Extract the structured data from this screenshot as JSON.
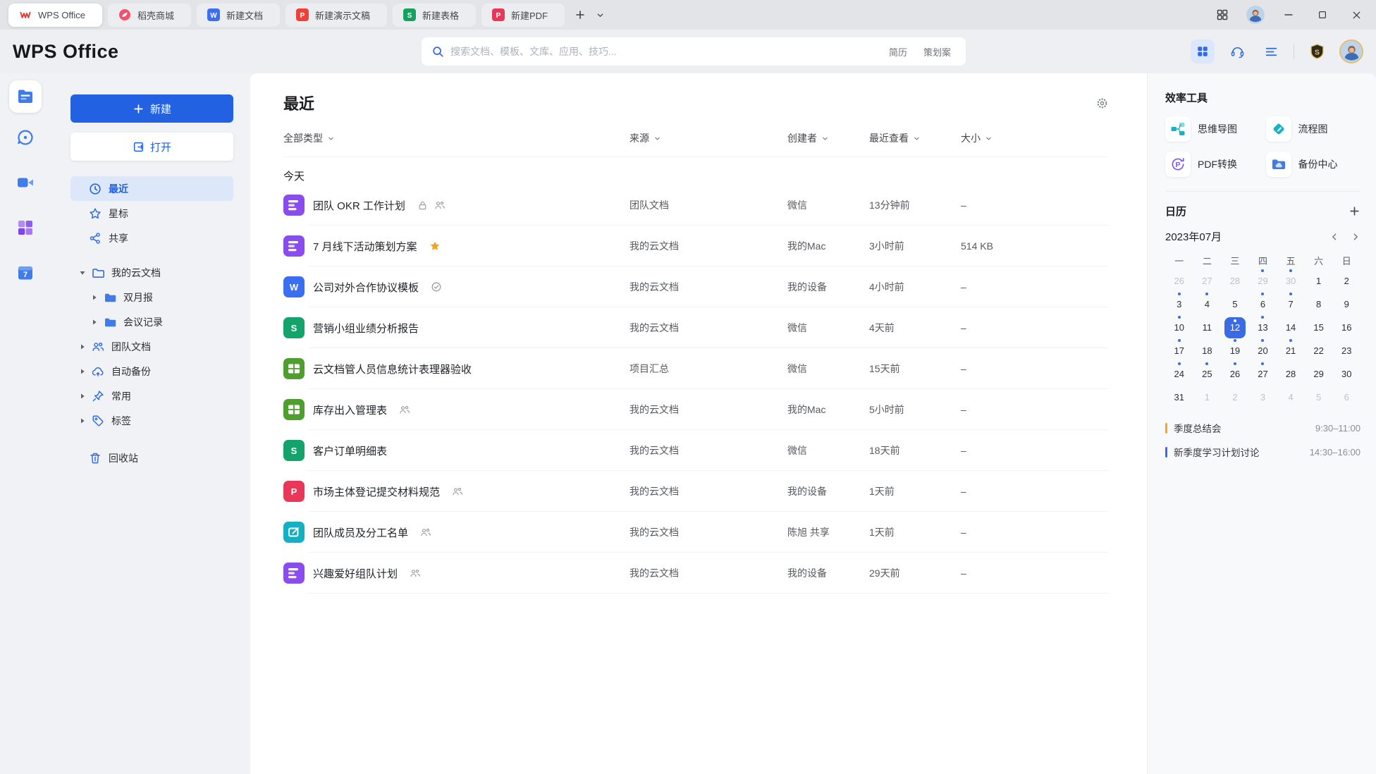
{
  "titlebar": {
    "tabs": [
      {
        "id": "wps-office",
        "label": "WPS Office",
        "active": true
      },
      {
        "id": "docer-mall",
        "label": "稻壳商城"
      },
      {
        "id": "new-doc",
        "label": "新建文档"
      },
      {
        "id": "new-ppt",
        "label": "新建演示文稿"
      },
      {
        "id": "new-sheet",
        "label": "新建表格"
      },
      {
        "id": "new-pdf",
        "label": "新建PDF"
      }
    ]
  },
  "header": {
    "logo": "WPS Office",
    "search_placeholder": "搜索文档、模板、文库、应用、技巧...",
    "search_tags": [
      "简历",
      "策划案"
    ]
  },
  "rail": {
    "items": [
      {
        "id": "docs",
        "active": true
      },
      {
        "id": "chat"
      },
      {
        "id": "meeting"
      },
      {
        "id": "apps"
      },
      {
        "id": "calendar"
      }
    ]
  },
  "sidebar": {
    "new_button": "新建",
    "open_button": "打开",
    "nav": [
      {
        "id": "recent",
        "icon": "clock",
        "label": "最近",
        "active": true
      },
      {
        "id": "starred",
        "icon": "star",
        "label": "星标"
      },
      {
        "id": "shared",
        "icon": "share",
        "label": "共享"
      }
    ],
    "tree": [
      {
        "id": "my-cloud-docs",
        "icon": "folder-outline",
        "caret": "down",
        "label": "我的云文档"
      },
      {
        "id": "bimonthly-report",
        "icon": "folder",
        "caret": "right",
        "label": "双月报",
        "child": true
      },
      {
        "id": "meeting-notes",
        "icon": "folder",
        "caret": "right",
        "label": "会议记录",
        "child": true
      },
      {
        "id": "team-docs",
        "icon": "team",
        "caret": "right",
        "label": "团队文档"
      },
      {
        "id": "auto-backup",
        "icon": "cloud-backup",
        "caret": "right",
        "label": "自动备份"
      },
      {
        "id": "frequent",
        "icon": "pin",
        "caret": "right",
        "label": "常用"
      },
      {
        "id": "tags",
        "icon": "tag",
        "caret": "right",
        "label": "标签"
      }
    ],
    "trash_label": "回收站"
  },
  "main": {
    "title": "最近",
    "filters": [
      {
        "id": "type",
        "label": "全部类型"
      },
      {
        "id": "source",
        "label": "来源"
      },
      {
        "id": "creator",
        "label": "创建者"
      },
      {
        "id": "viewed",
        "label": "最近查看"
      },
      {
        "id": "size",
        "label": "大小"
      }
    ],
    "group_label": "今天",
    "files": [
      {
        "name": "团队 OKR 工作计划",
        "icon": "docs",
        "badges": [
          "lock",
          "people"
        ],
        "source": "团队文档",
        "creator": "微信",
        "viewed": "13分钟前",
        "size": "–"
      },
      {
        "name": "7 月线下活动策划方案",
        "icon": "docs",
        "badges": [
          "star"
        ],
        "source": "我的云文档",
        "creator": "我的Mac",
        "viewed": "3小时前",
        "size": "514 KB"
      },
      {
        "name": "公司对外合作协议模板",
        "icon": "word",
        "badges": [
          "check"
        ],
        "source": "我的云文档",
        "creator": "我的设备",
        "viewed": "4小时前",
        "size": "–"
      },
      {
        "name": "营销小组业绩分析报告",
        "icon": "sheet",
        "badges": [],
        "source": "我的云文档",
        "creator": "微信",
        "viewed": "4天前",
        "size": "–"
      },
      {
        "name": "云文档管人员信息统计表理器验收",
        "icon": "table",
        "badges": [],
        "source": "项目汇总",
        "creator": "微信",
        "viewed": "15天前",
        "size": "–"
      },
      {
        "name": "库存出入管理表",
        "icon": "table",
        "badges": [
          "people"
        ],
        "source": "我的云文档",
        "creator": "我的Mac",
        "viewed": "5小时前",
        "size": "–"
      },
      {
        "name": "客户订单明细表",
        "icon": "sheet",
        "badges": [],
        "source": "我的云文档",
        "creator": "微信",
        "viewed": "18天前",
        "size": "–"
      },
      {
        "name": "市场主体登记提交材料规范",
        "icon": "pdf",
        "badges": [
          "people"
        ],
        "source": "我的云文档",
        "creator": "我的设备",
        "viewed": "1天前",
        "size": "–"
      },
      {
        "name": "团队成员及分工名单",
        "icon": "form",
        "badges": [
          "people"
        ],
        "source": "我的云文档",
        "creator": "陈旭 共享",
        "viewed": "1天前",
        "size": "–"
      },
      {
        "name": "兴趣爱好组队计划",
        "icon": "docs",
        "badges": [
          "people"
        ],
        "source": "我的云文档",
        "creator": "我的设备",
        "viewed": "29天前",
        "size": "–"
      }
    ]
  },
  "right_panel": {
    "tools_title": "效率工具",
    "tools": [
      {
        "id": "mindmap",
        "label": "思维导图"
      },
      {
        "id": "flowchart",
        "label": "流程图"
      },
      {
        "id": "pdf-convert",
        "label": "PDF转换"
      },
      {
        "id": "backup",
        "label": "备份中心"
      }
    ],
    "calendar": {
      "title": "日历",
      "month": "2023年07月",
      "weekdays": [
        "一",
        "二",
        "三",
        "四",
        "五",
        "六",
        "日"
      ],
      "days": [
        {
          "d": 26,
          "muted": true
        },
        {
          "d": 27,
          "muted": true
        },
        {
          "d": 28,
          "muted": true
        },
        {
          "d": 29,
          "muted": true,
          "dot": true
        },
        {
          "d": 30,
          "muted": true,
          "dot": true
        },
        {
          "d": 1
        },
        {
          "d": 2
        },
        {
          "d": 3,
          "dot": true
        },
        {
          "d": 4,
          "dot": true
        },
        {
          "d": 5
        },
        {
          "d": 6,
          "dot": true
        },
        {
          "d": 7,
          "dot": true
        },
        {
          "d": 8
        },
        {
          "d": 9
        },
        {
          "d": 10,
          "dot": true
        },
        {
          "d": 11
        },
        {
          "d": 12,
          "selected": true,
          "dot": true
        },
        {
          "d": 13,
          "dot": true
        },
        {
          "d": 14
        },
        {
          "d": 15
        },
        {
          "d": 16
        },
        {
          "d": 17,
          "dot": true
        },
        {
          "d": 18
        },
        {
          "d": 19,
          "dot": true
        },
        {
          "d": 20,
          "dot": true
        },
        {
          "d": 21,
          "dot": true
        },
        {
          "d": 22
        },
        {
          "d": 23
        },
        {
          "d": 24,
          "dot": true
        },
        {
          "d": 25,
          "dot": true
        },
        {
          "d": 26,
          "dot": true
        },
        {
          "d": 27,
          "dot": true
        },
        {
          "d": 28
        },
        {
          "d": 29
        },
        {
          "d": 30
        },
        {
          "d": 31
        },
        {
          "d": 1,
          "muted": true
        },
        {
          "d": 2,
          "muted": true
        },
        {
          "d": 3,
          "muted": true
        },
        {
          "d": 4,
          "muted": true
        },
        {
          "d": 5,
          "muted": true
        },
        {
          "d": 6,
          "muted": true
        }
      ],
      "events": [
        {
          "title": "季度总结会",
          "time": "9:30–11:00",
          "color": "#f5a623"
        },
        {
          "title": "新季度学习计划讨论",
          "time": "14:30–16:00",
          "color": "#3b6be4"
        }
      ]
    }
  },
  "colors": {
    "accent": "#2161e2",
    "star": "#f0a41f",
    "docs_icon": "#8a4bef",
    "word_icon": "#3a6ff2",
    "sheet_icon": "#14a36b",
    "table_icon": "#4f9f2f",
    "pdf_icon": "#e9375a",
    "form_icon": "#13b0c4",
    "tool_teal": "#14b3c7",
    "tool_purple": "#7a52f4",
    "folder_blue": "#3f7bea",
    "calendar_selected": "#3b6be4"
  }
}
